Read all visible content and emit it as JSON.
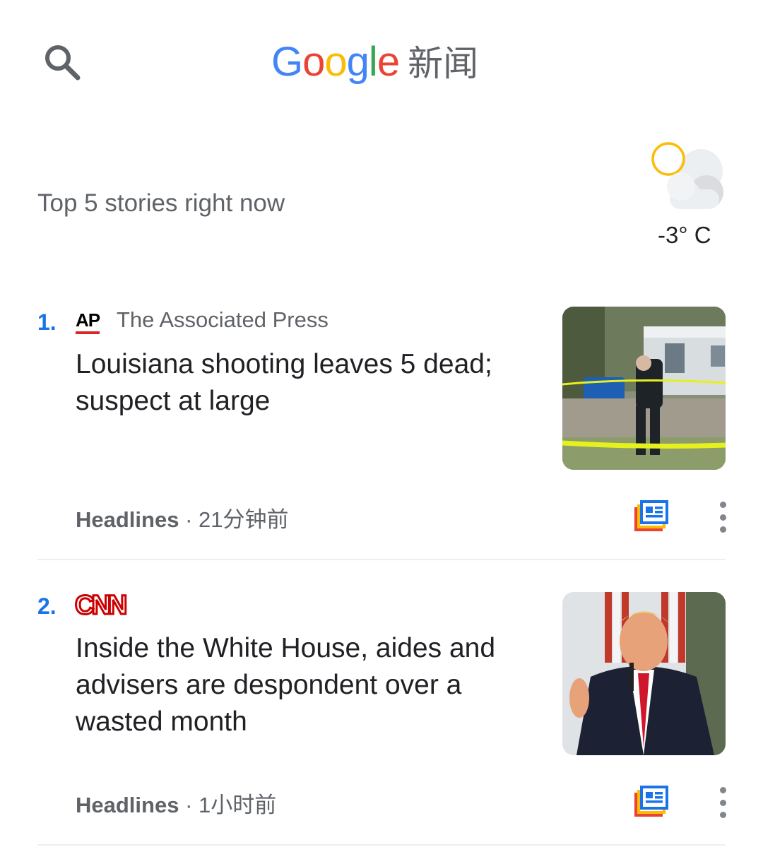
{
  "header": {
    "logo_letters": [
      {
        "ch": "G",
        "color": "#4285F4"
      },
      {
        "ch": "o",
        "color": "#EA4335"
      },
      {
        "ch": "o",
        "color": "#FBBC05"
      },
      {
        "ch": "g",
        "color": "#4285F4"
      },
      {
        "ch": "l",
        "color": "#34A853"
      },
      {
        "ch": "e",
        "color": "#EA4335"
      }
    ],
    "logo_suffix": "新闻",
    "search_icon": "search-icon"
  },
  "section": {
    "title": "Top 5 stories right now"
  },
  "weather": {
    "icon": "partly-cloudy-icon",
    "temperature": "-3° C"
  },
  "stories": [
    {
      "rank": "1.",
      "source_logo": "AP",
      "source_name": "The Associated Press",
      "headline": "Louisiana shooting leaves 5 dead; suspect at large",
      "category": "Headlines",
      "separator": " · ",
      "time": "21分钟前",
      "thumbnail": "crime-scene-photo",
      "coverage_icon": "full-coverage-icon",
      "menu_icon": "more-vert-icon"
    },
    {
      "rank": "2.",
      "source_logo": "CNN",
      "source_name": "",
      "headline": "Inside the White House, aides and advisers are despondent over a wasted month",
      "category": "Headlines",
      "separator": " · ",
      "time": "1小时前",
      "thumbnail": "press-briefing-photo",
      "coverage_icon": "full-coverage-icon",
      "menu_icon": "more-vert-icon"
    }
  ],
  "colors": {
    "accent_blue": "#1a73e8",
    "ap_red": "#d62828",
    "cnn_red": "#cc0000",
    "weather_sun": "#fbbc05"
  }
}
